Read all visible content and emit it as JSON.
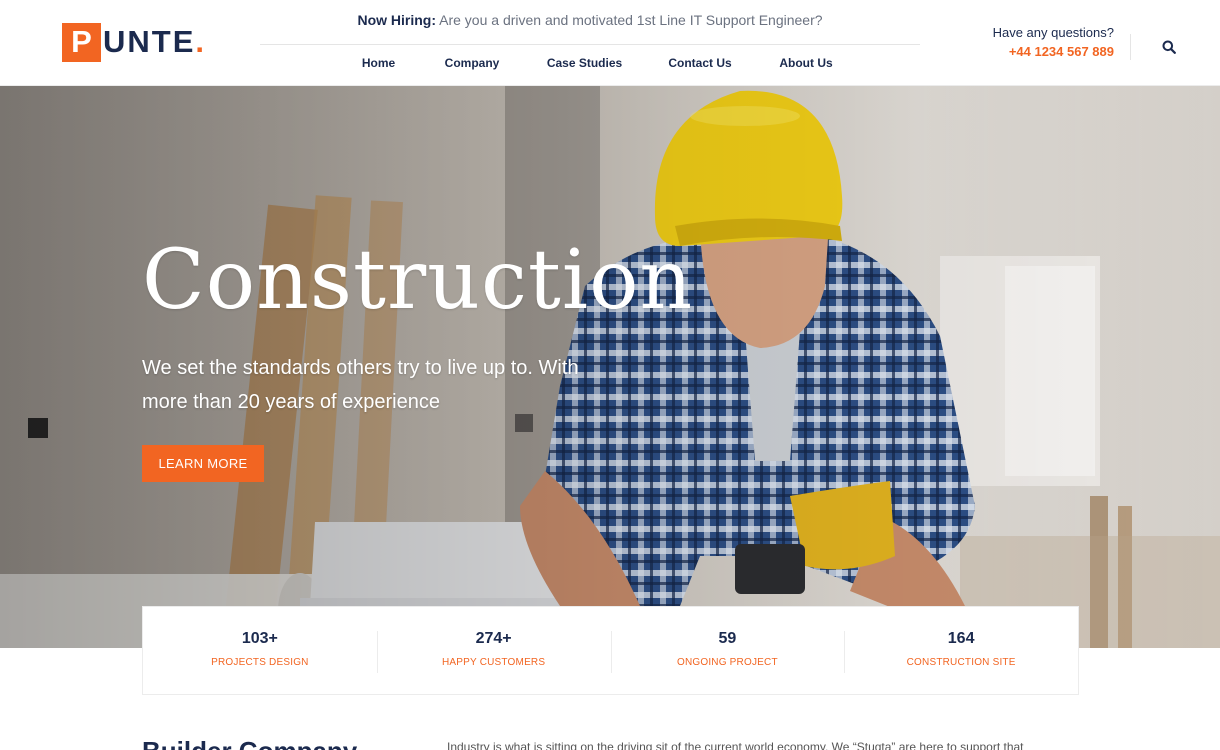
{
  "header": {
    "logo": {
      "letter": "P",
      "rest": "UNTE",
      "dot": "."
    },
    "hiring": {
      "label": "Now Hiring:",
      "text": "Are you a driven and motivated 1st Line IT Support Engineer?"
    },
    "nav": [
      {
        "label": "Home"
      },
      {
        "label": "Company"
      },
      {
        "label": "Case Studies"
      },
      {
        "label": "Contact Us"
      },
      {
        "label": "About Us"
      }
    ],
    "contact": {
      "label": "Have any questions?",
      "phone": "+44 1234 567 889"
    },
    "search_icon": "search-icon"
  },
  "hero": {
    "title": "Construction",
    "subtitle": "We set the standards others try to live up to. With more than 20 years of experience",
    "button": "LEARN MORE"
  },
  "stats": [
    {
      "value": "103+",
      "label": "PROJECTS DESIGN"
    },
    {
      "value": "274+",
      "label": "HAPPY CUSTOMERS"
    },
    {
      "value": "59",
      "label": "ONGOING PROJECT"
    },
    {
      "value": "164",
      "label": "CONSTRUCTION SITE"
    }
  ],
  "about": {
    "title": "Builder Company",
    "text": "Industry is what is sitting on the driving sit of the current world economy. We “Stuqta” are here to support that"
  },
  "colors": {
    "accent": "#f26522",
    "navy": "#1b2a4e"
  }
}
